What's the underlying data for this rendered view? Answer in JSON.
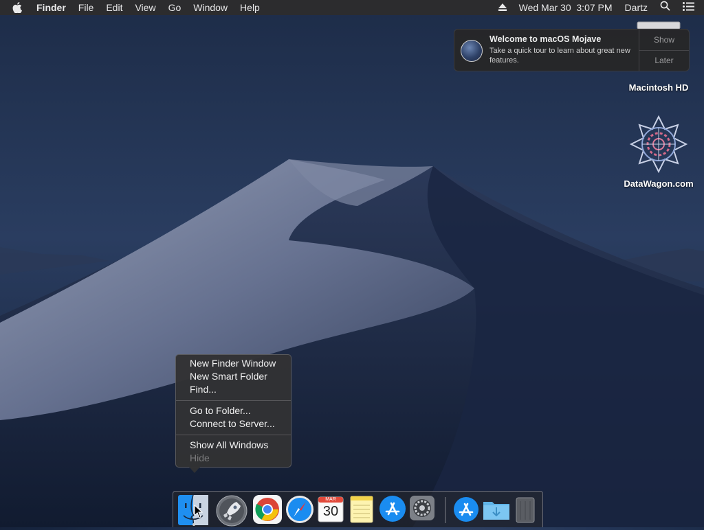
{
  "menubar": {
    "apple_icon": "apple-logo-icon",
    "app_name": "Finder",
    "menus": [
      "File",
      "Edit",
      "View",
      "Go",
      "Window",
      "Help"
    ],
    "eject_icon": "eject-icon",
    "datetime": "Wed Mar 30  3:07 PM",
    "user": "Dartz",
    "search_icon": "spotlight-search-icon",
    "notification_icon": "notification-center-icon"
  },
  "notification": {
    "title": "Welcome to macOS Mojave",
    "body": "Take a quick tour to learn about great new features.",
    "show_label": "Show",
    "later_label": "Later"
  },
  "desktop": {
    "icons": [
      {
        "label": "Macintosh HD",
        "icon": "hard-drive-icon"
      },
      {
        "label": "DataWagon.com",
        "icon": "datawagon-logo-icon"
      }
    ]
  },
  "context_menu": {
    "group1": [
      "New Finder Window",
      "New Smart Folder",
      "Find..."
    ],
    "group2": [
      "Go to Folder...",
      "Connect to Server..."
    ],
    "group3": [
      "Show All Windows"
    ],
    "disabled": "Hide"
  },
  "dock": {
    "apps": [
      "finder-icon",
      "launchpad-icon",
      "chrome-icon",
      "safari-icon",
      "calendar-icon",
      "notes-icon",
      "app-store-icon",
      "system-preferences-icon",
      "app-store-download-icon",
      "downloads-folder-icon",
      "trash-icon"
    ],
    "calendar_month": "MAR",
    "calendar_day": "30"
  },
  "colors": {
    "menubar_bg": "#2c2c2e",
    "menu_bg": "#323234",
    "wallpaper_top": "#233556"
  }
}
